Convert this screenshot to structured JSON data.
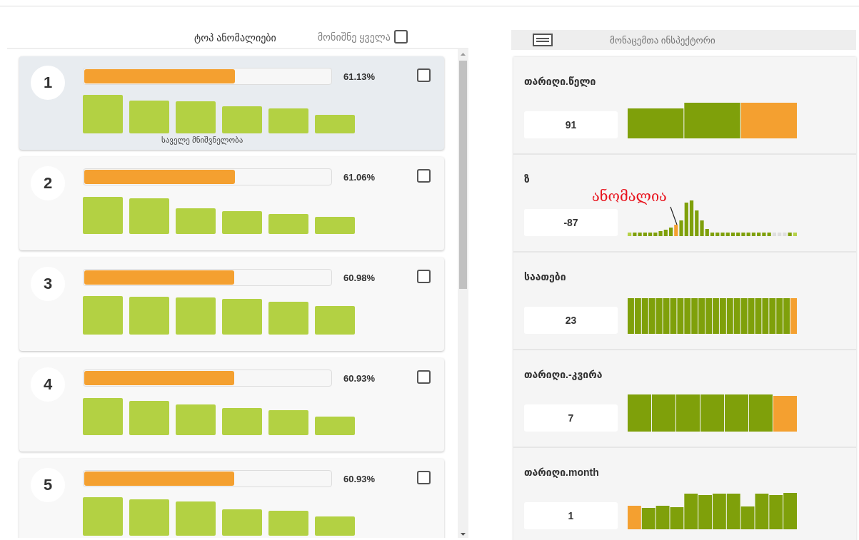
{
  "left_panel": {
    "title": "ტოპ ანომალიები",
    "select_all": {
      "label": "მონიშნე ყველა",
      "checked": false
    }
  },
  "anomalies": [
    {
      "rank": "1",
      "level": 0.6113,
      "score": "61.13%",
      "checked": false,
      "selected": true,
      "caption": "საველე მნიშვნელობა"
    },
    {
      "rank": "2",
      "level": 0.6106,
      "score": "61.06%",
      "checked": false,
      "selected": false
    },
    {
      "rank": "3",
      "level": 0.6098,
      "score": "60.98%",
      "checked": false,
      "selected": false
    },
    {
      "rank": "4",
      "level": 0.6093,
      "score": "60.93%",
      "checked": false,
      "selected": false
    },
    {
      "rank": "5",
      "level": 0.6093,
      "score": "60.93%",
      "checked": false,
      "selected": false
    }
  ],
  "inspector": {
    "title": "მონაცემთა ინსპექტორი"
  },
  "features": [
    {
      "name": "თარიღი.წელი",
      "value": "91"
    },
    {
      "name": "ზ",
      "value": "-87",
      "annotation": "ანომალია"
    },
    {
      "name": "საათები",
      "value": "23"
    },
    {
      "name": "თარიღი.-კვირა",
      "value": "7"
    },
    {
      "name": "თარიღი.month",
      "value": "1"
    }
  ]
}
